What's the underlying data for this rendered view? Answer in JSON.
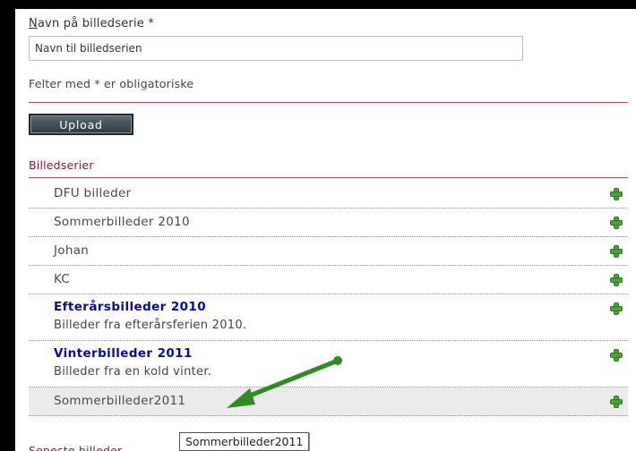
{
  "form": {
    "name_label_first": "N",
    "name_label_rest": "avn på billedserie *",
    "name_value": "Navn til billedserien",
    "required_note": "Felter med * er obligatoriske",
    "upload_label": "Upload"
  },
  "series": {
    "title": "Billedserier",
    "items": [
      {
        "title": "DFU billeder",
        "desc": "",
        "style": "simple"
      },
      {
        "title": "Sommerbilleder 2010",
        "desc": "",
        "style": "simple"
      },
      {
        "title": "Johan",
        "desc": "",
        "style": "simple"
      },
      {
        "title": "KC",
        "desc": "",
        "style": "simple"
      },
      {
        "title": "Efterårsbilleder 2010",
        "desc": "Billeder fra efterårsferien 2010.",
        "style": "rich"
      },
      {
        "title": "Vinterbilleder 2011",
        "desc": "Billeder fra en kold vinter.",
        "style": "rich"
      },
      {
        "title": "Sommerbilleder2011",
        "desc": "",
        "style": "simple",
        "highlight": true
      }
    ]
  },
  "tooltip": "Sommerbilleder2011",
  "bottom_label": "Seneste billeder",
  "colors": {
    "accent_red": "#8b1f2a",
    "link_blue": "#0a0aa0",
    "add_green": "#4aa238",
    "arrow_green": "#2e8b1f"
  },
  "icons": {
    "add": "plus-icon",
    "annotation": "arrow-icon"
  }
}
